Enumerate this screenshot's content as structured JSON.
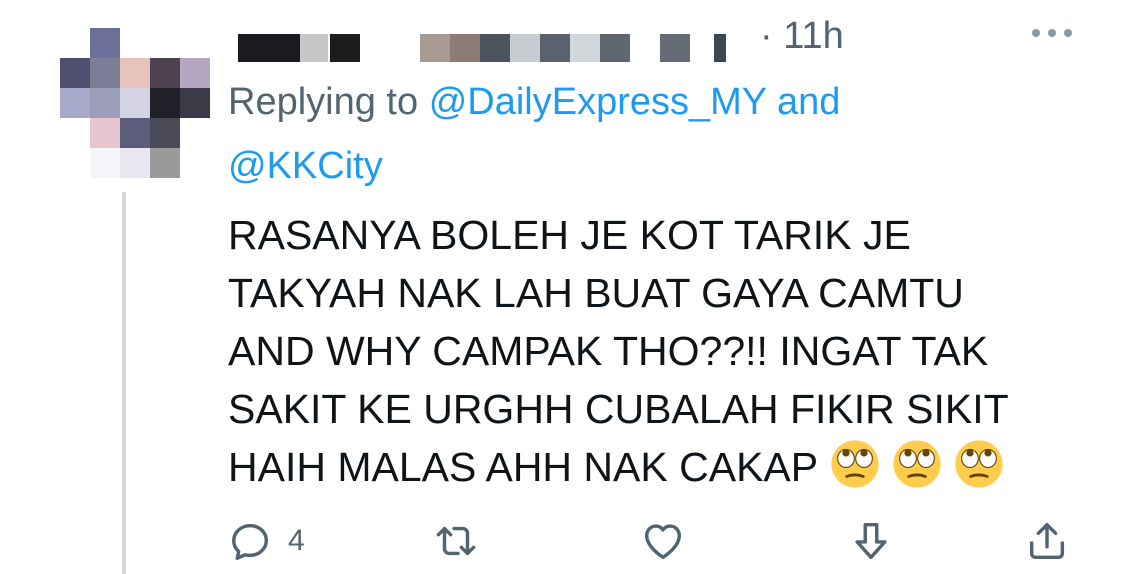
{
  "tweet": {
    "timestamp": "11h",
    "separator": "·",
    "replying_to_label": "Replying to",
    "mentions": [
      "@DailyExpress_MY",
      "@KKCity"
    ],
    "and_label": "and",
    "text_lines": [
      "RASANYA BOLEH JE KOT TARIK JE",
      "TAKYAH NAK LAH BUAT GAYA CAMTU",
      "AND WHY CAMPAK THO??!! INGAT TAK",
      "SAKIT KE URGHH CUBALAH FIKIR SIKIT",
      "HAIH MALAS AHH NAK CAKAP"
    ],
    "emoji": "face-with-rolling-eyes",
    "emoji_count": 3
  },
  "actions": {
    "reply_count": "4",
    "retweet_count": "",
    "like_count": ""
  },
  "icons": {
    "more": "more-icon",
    "reply": "reply-icon",
    "retweet": "retweet-icon",
    "like": "like-icon",
    "bookmark": "bookmark-icon",
    "share": "share-icon"
  },
  "colors": {
    "text": "#0f1419",
    "secondary": "#536471",
    "link": "#1d9bf0"
  }
}
